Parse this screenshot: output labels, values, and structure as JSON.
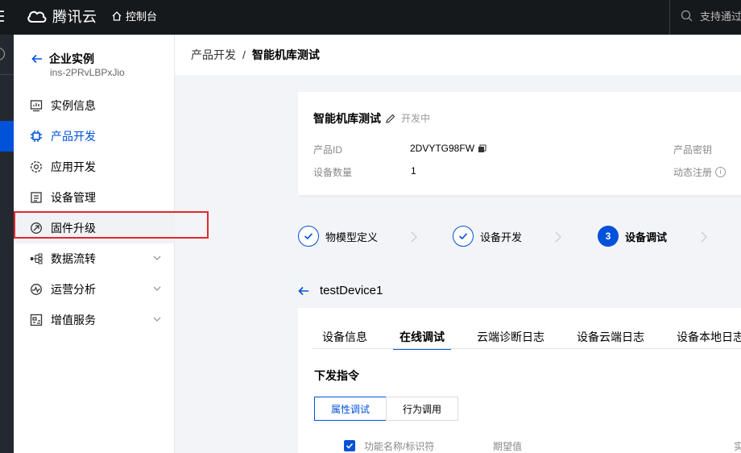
{
  "topbar": {
    "brand": "腾讯云",
    "console": "控制台",
    "search_placeholder": "支持通过"
  },
  "sidebar": {
    "back_title": "企业实例",
    "instance_id": "ins-2PRvLBPxJio",
    "items": [
      {
        "label": "实例信息",
        "icon": "instance-info-icon"
      },
      {
        "label": "产品开发",
        "icon": "chip-icon",
        "active": true
      },
      {
        "label": "应用开发",
        "icon": "app-dev-icon"
      },
      {
        "label": "设备管理",
        "icon": "device-list-icon"
      },
      {
        "label": "固件升级",
        "icon": "firmware-upgrade-icon",
        "highlighted": true
      },
      {
        "label": "数据流转",
        "icon": "data-flow-icon",
        "expandable": true
      },
      {
        "label": "运营分析",
        "icon": "analytics-icon",
        "expandable": true
      },
      {
        "label": "增值服务",
        "icon": "value-added-icon",
        "expandable": true
      }
    ]
  },
  "breadcrumb": {
    "parent": "产品开发",
    "separator": "/",
    "current": "智能机库测试"
  },
  "product_card": {
    "name": "智能机库测试",
    "status": "开发中",
    "product_id_label": "产品ID",
    "product_id": "2DVYTG98FW",
    "device_count_label": "设备数量",
    "device_count": "1",
    "secret_label": "产品密钥",
    "dynamic_reg_label": "动态注册"
  },
  "steps": [
    {
      "label": "物模型定义",
      "state": "done"
    },
    {
      "label": "设备开发",
      "state": "done"
    },
    {
      "number": "3",
      "label": "设备调试",
      "state": "current"
    }
  ],
  "device": {
    "name": "testDevice1"
  },
  "tabs": [
    "设备信息",
    "在线调试",
    "云端诊断日志",
    "设备云端日志",
    "设备本地日志"
  ],
  "active_tab": "在线调试",
  "section": {
    "title": "下发指令",
    "seg_on": "属性调试",
    "seg_off": "行为调用",
    "col_name": "功能名称/标识符",
    "col_expected": "期望值",
    "col_partial": "实"
  },
  "colors": {
    "accent": "#0052d9",
    "topbar": "#16191c",
    "highlight": "#e0282e"
  }
}
